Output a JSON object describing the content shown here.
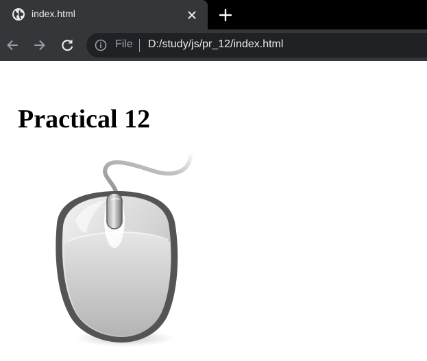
{
  "browser": {
    "tab": {
      "title": "index.html",
      "favicon": "globe-icon"
    },
    "toolbar": {
      "back_icon": "back-arrow-icon",
      "forward_icon": "forward-arrow-icon",
      "reload_icon": "reload-icon",
      "address": {
        "scheme_label": "File",
        "url": "D:/study/js/pr_12/index.html"
      }
    },
    "colors": {
      "tabstrip": "#000000",
      "active_tab": "#35363a",
      "omnibox": "#202124",
      "text": "#e8eaed",
      "muted_text": "#9aa0a6"
    }
  },
  "page": {
    "heading": "Practical 12",
    "image": "computer-mouse-image"
  }
}
